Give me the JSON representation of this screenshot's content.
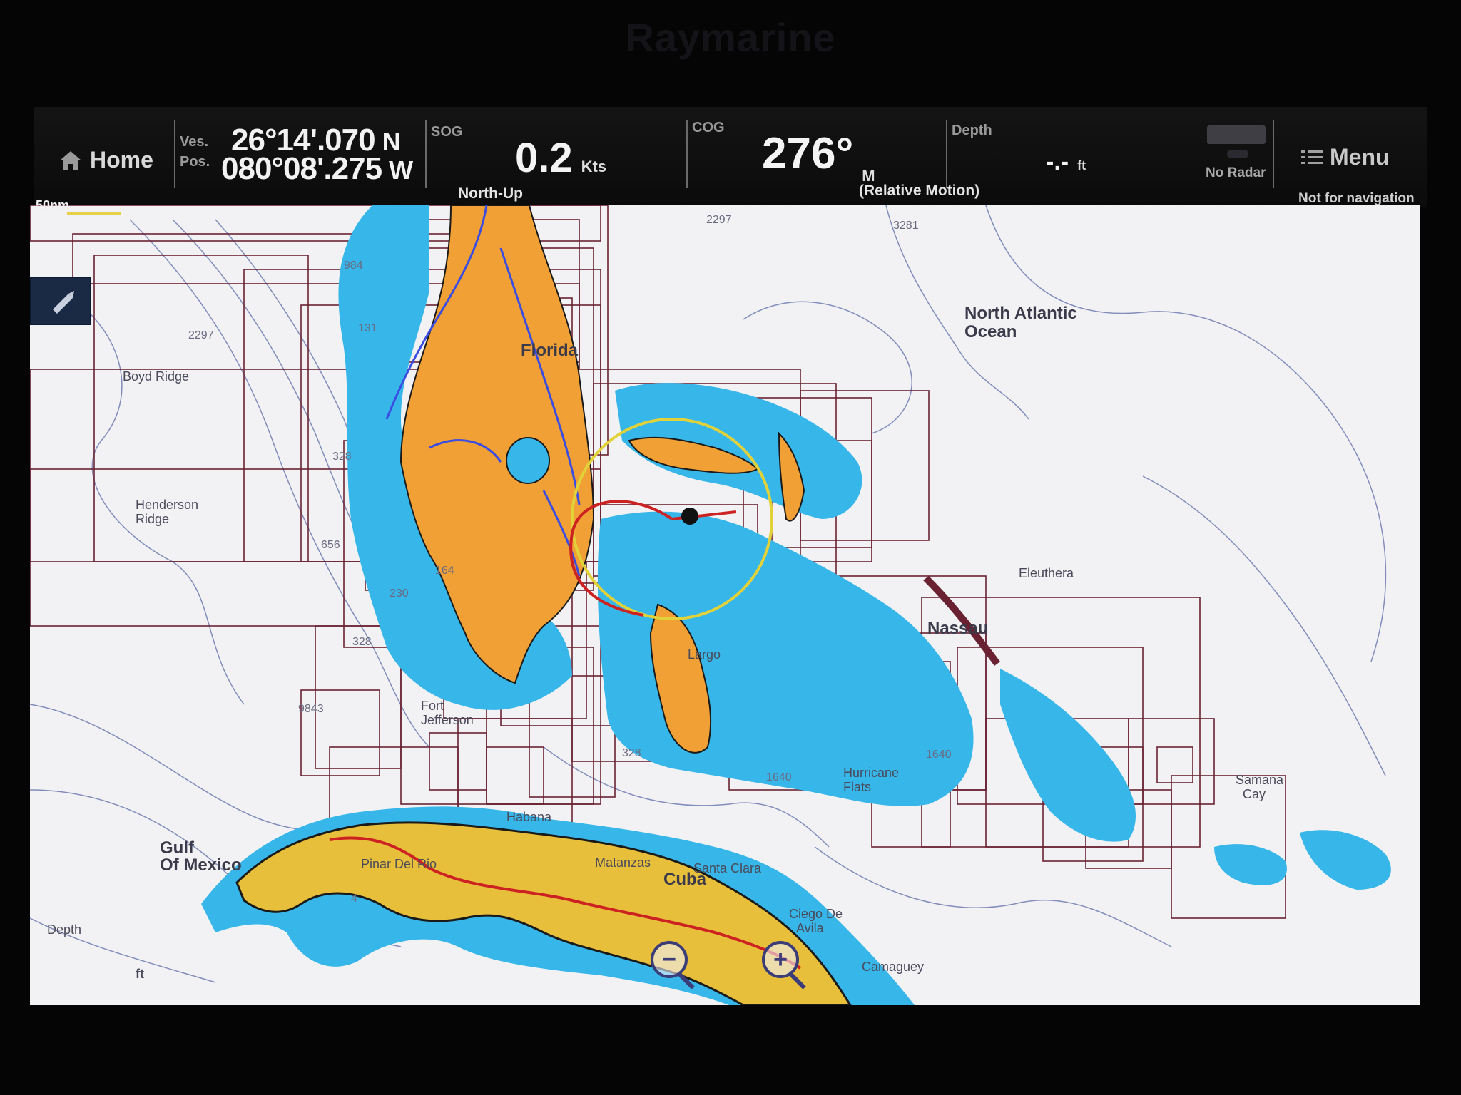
{
  "header": {
    "brand": "Raymarine",
    "home_label": "Home",
    "ves_label": "Ves.",
    "pos_label": "Pos.",
    "latitude": "26°14'.070",
    "lat_hemisphere": "N",
    "longitude": "080°08'.275",
    "lon_hemisphere": "W",
    "sog_label": "SOG",
    "sog_value": "0.2",
    "sog_unit": "Kts",
    "orientation": "North-Up",
    "cog_label": "COG",
    "cog_value": "276°",
    "cog_unit": "M",
    "motion_mode": "(Relative Motion)",
    "depth_label": "Depth",
    "depth_value": "-.-",
    "depth_unit": "ft",
    "radar_status": "No Radar",
    "menu_label": "Menu",
    "warning": "Not for navigation"
  },
  "map": {
    "scale_label": "50nm",
    "place_labels": {
      "north_atlantic": "North Atlantic",
      "ocean": "Ocean",
      "florida": "Florida",
      "gulf": "Gulf",
      "of_mexico": "Of Mexico",
      "cuba": "Cuba",
      "nassau": "Nassau",
      "boyd_ridge": "Boyd Ridge",
      "henderson": "Henderson",
      "ridge": "Ridge",
      "fort": "Fort",
      "jefferson": "Jefferson",
      "pinar_del_rio": "Pinar Del Rio",
      "matanzas": "Matanzas",
      "santa_clara": "Santa Clara",
      "ciego_de": "Ciego De",
      "avila": "Avila",
      "camaguey": "Camaguey",
      "hurricane": "Hurricane",
      "flats": "Flats",
      "eleuthera": "Eleuthera",
      "samana": "Samana",
      "cay": "Cay",
      "largo": "Largo",
      "habana": "Habana",
      "depth_word": "Depth"
    },
    "depth_soundings": [
      "3281",
      "2297",
      "131",
      "328",
      "656",
      "164",
      "230",
      "328",
      "9843",
      "1640",
      "328",
      "1640",
      "2297",
      "984",
      "4"
    ],
    "depth_unit_label": "ft",
    "colors": {
      "land": "#f0a035",
      "cuba_land": "#e8bf3a",
      "shallow": "#37b6ea",
      "shallow_light": "#8fd6f4",
      "sea": "#f2f2f4",
      "chart_grid": "#6a2233",
      "contour": "#5d6aa8",
      "route": "#cc2222",
      "range_ring": "#e2d23a"
    },
    "zoom_out_icon": "zoom-out-icon",
    "zoom_in_icon": "zoom-in-icon"
  }
}
